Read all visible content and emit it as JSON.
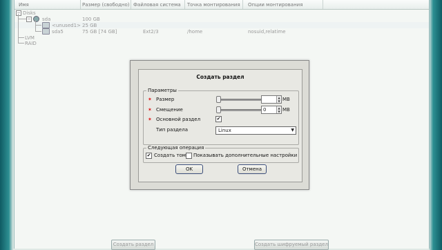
{
  "columns": [
    "Имя",
    "Размер (свободно)",
    "Файловая система",
    "Точка монтирования",
    "Опции монтирования"
  ],
  "tree": {
    "disks_label": "Disks",
    "sda": {
      "name": "sda",
      "size": "100 GB"
    },
    "unused": {
      "name": "<unused1>",
      "size": "25 GB"
    },
    "sda5": {
      "name": "sda5",
      "size": "75 GB [74 GB]",
      "fs": "Ext2/3",
      "mount": "/home",
      "options": "nosuid,relatime"
    },
    "lvm_label": "LVM",
    "raid_label": "RAID"
  },
  "dialog": {
    "title": "Создать раздел",
    "params_group": "Параметры",
    "size_label": "Размер",
    "size_value": "",
    "size_unit": "MB",
    "offset_label": "Смещение",
    "offset_value": "0",
    "offset_unit": "MB",
    "primary_label": "Основной раздел",
    "primary_checked": "✔",
    "type_label": "Тип раздела",
    "type_value": "Linux",
    "next_group": "Следующая операция",
    "create_volume_label": "Создать том",
    "create_volume_checked": "✔",
    "advanced_label": "Показывать дополнительные настройки",
    "ok_label": "OK",
    "cancel_label": "Отмена"
  },
  "bottom": {
    "create_partition": "Создать раздел",
    "create_encrypted": "Создать шифруемый раздел"
  }
}
